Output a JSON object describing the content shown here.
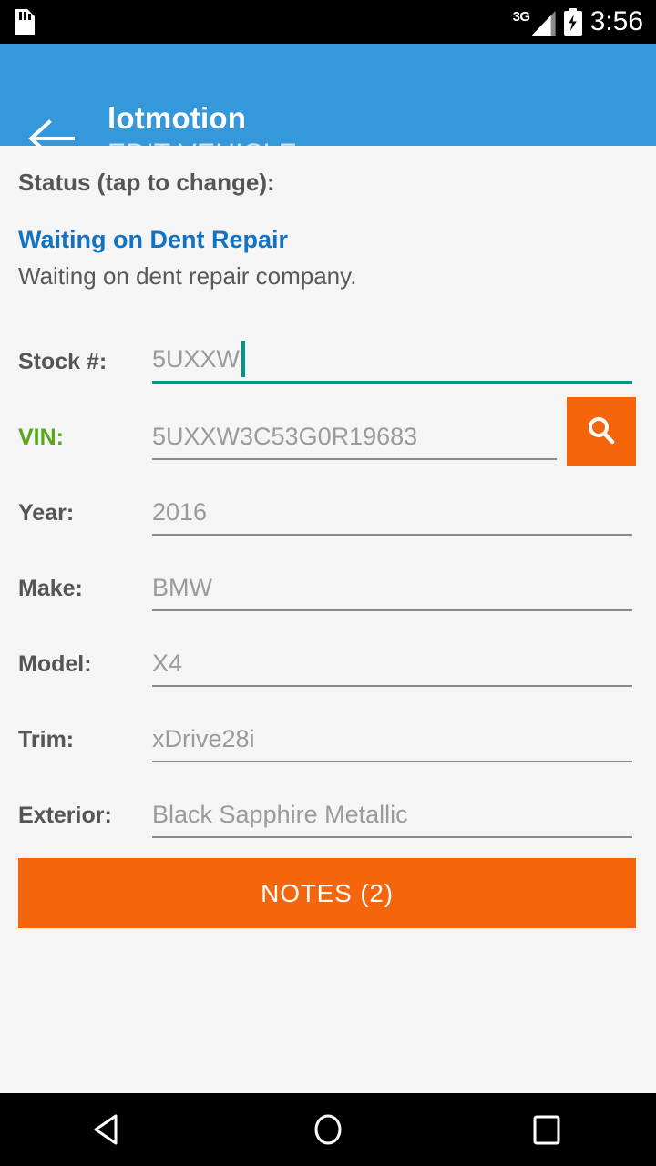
{
  "statusbar": {
    "sd_icon": "sd-card-icon",
    "network_label": "3G",
    "signal_icon": "signal-icon",
    "battery_icon": "battery-charging-icon",
    "time": "3:56"
  },
  "appbar": {
    "back_icon": "back-arrow-icon",
    "title": "lotmotion",
    "subtitle": "EDIT VEHICLE",
    "background_color": "#3498db"
  },
  "status_section": {
    "label": "Status (tap to change):",
    "value": "Waiting on Dent Repair",
    "value_color": "#1273c4",
    "description": "Waiting on dent repair company."
  },
  "form": {
    "fields": [
      {
        "label": "Stock #:",
        "value": "5UXXW",
        "focused": true,
        "label_color": "#555555"
      },
      {
        "label": "VIN:",
        "value": "5UXXW3C53G0R19683",
        "focused": false,
        "label_color": "#57a917"
      },
      {
        "label": "Year:",
        "value": "2016",
        "focused": false,
        "label_color": "#555555"
      },
      {
        "label": "Make:",
        "value": "BMW",
        "focused": false,
        "label_color": "#555555"
      },
      {
        "label": "Model:",
        "value": "X4",
        "focused": false,
        "label_color": "#555555"
      },
      {
        "label": "Trim:",
        "value": "xDrive28i",
        "focused": false,
        "label_color": "#555555"
      },
      {
        "label": "Exterior:",
        "value": "Black Sapphire Metallic",
        "focused": false,
        "label_color": "#555555"
      }
    ],
    "search_button": {
      "icon": "search-icon",
      "color": "#f4650c"
    },
    "focus_color": "#009688"
  },
  "notes_button": {
    "label": "NOTES (2)",
    "color": "#f4650c"
  },
  "navbar": {
    "back_icon": "nav-back-icon",
    "home_icon": "nav-home-icon",
    "recents_icon": "nav-recents-icon"
  }
}
